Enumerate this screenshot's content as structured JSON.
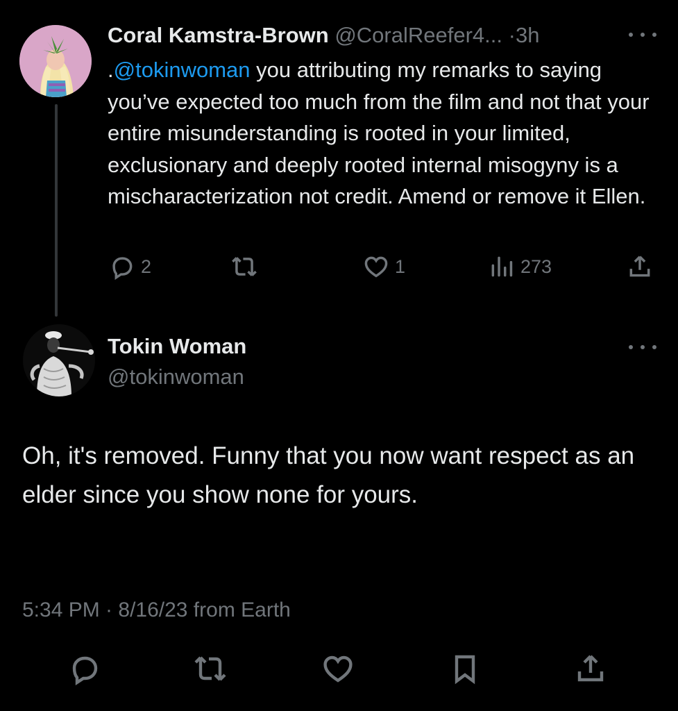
{
  "reply": {
    "display_name": "Coral Kamstra-Brown",
    "handle": "@CoralReefer4...",
    "separator": "·",
    "time_ago": "3h",
    "text_prefix": ".",
    "mention": "@tokinwoman",
    "text_body": " you attributing my remarks to saying you’ve expected too much from the film and not that your entire misunderstanding is rooted in your limited, exclusionary and deeply rooted internal misogyny is a mischaracterization not credit. Amend or remove it Ellen.",
    "actions": {
      "reply_count": "2",
      "retweet_count": "",
      "like_count": "1",
      "views_count": "273"
    },
    "icons": [
      "reply-icon",
      "retweet-icon",
      "heart-icon",
      "views-icon",
      "share-icon",
      "more-icon"
    ]
  },
  "main_tweet": {
    "display_name": "Tokin Woman",
    "handle": "@tokinwoman",
    "text": "Oh, it's removed. Funny that you now want respect as an elder since you show none for yours.",
    "meta": "5:34 PM · 8/16/23 from Earth",
    "bottom_icons": [
      "reply-icon",
      "retweet-icon",
      "heart-icon",
      "bookmark-icon",
      "share-icon"
    ]
  },
  "colors": {
    "background": "#000000",
    "text": "#e7e9ea",
    "muted": "#71767b",
    "link": "#1d9bf0",
    "thread_line": "#333639"
  }
}
